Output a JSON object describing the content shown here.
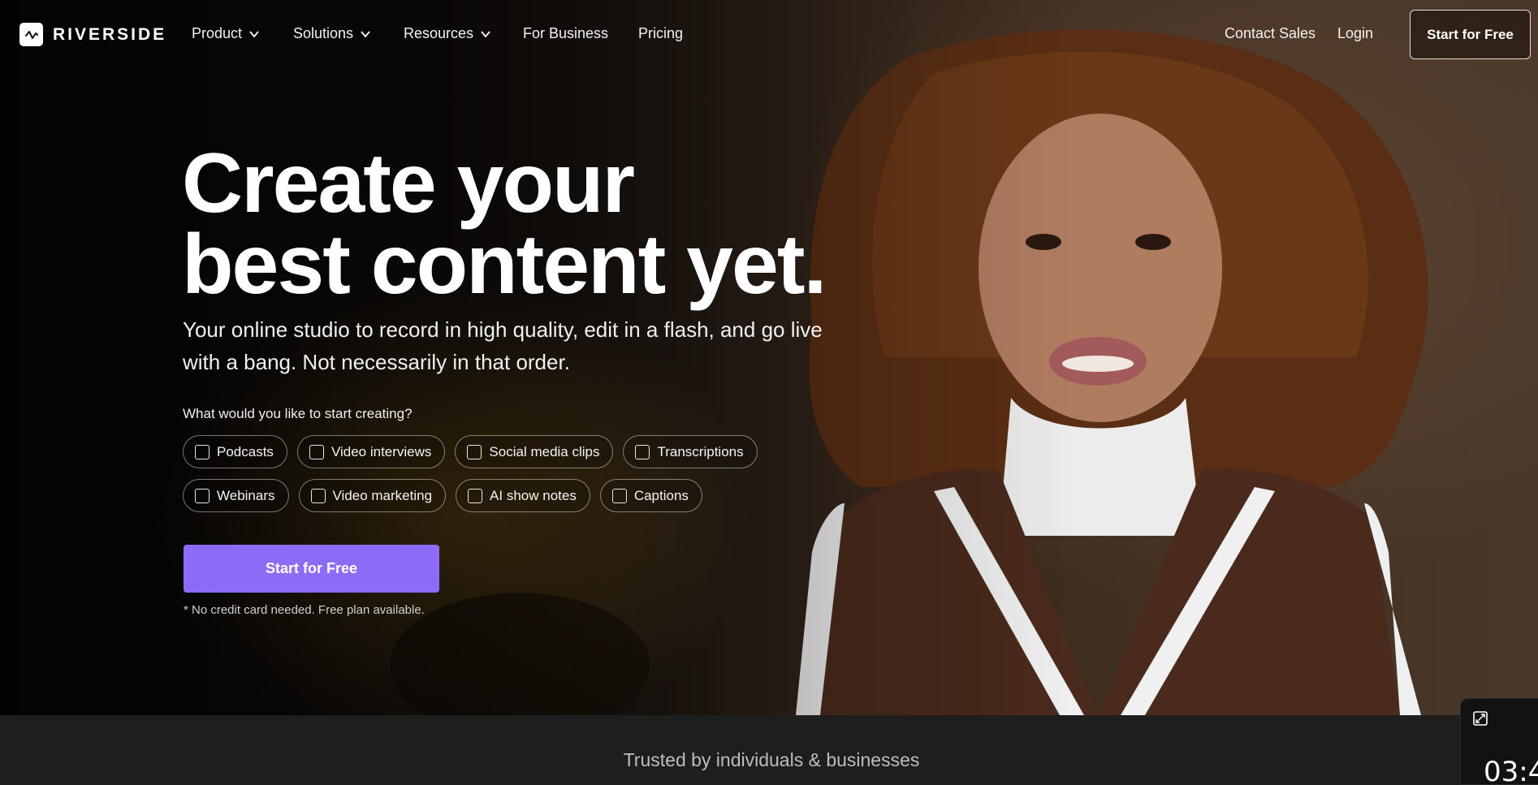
{
  "brand": {
    "name": "RIVERSIDE",
    "logo_icon": "waveform-icon"
  },
  "nav": {
    "items": [
      {
        "label": "Product",
        "has_dropdown": true
      },
      {
        "label": "Solutions",
        "has_dropdown": true
      },
      {
        "label": "Resources",
        "has_dropdown": true
      },
      {
        "label": "For Business",
        "has_dropdown": false
      },
      {
        "label": "Pricing",
        "has_dropdown": false
      }
    ],
    "contact_sales": "Contact Sales",
    "login": "Login",
    "cta": "Start for Free"
  },
  "hero": {
    "headline_line1": "Create your",
    "headline_line2": "best content yet.",
    "subtitle": "Your online studio to record in high quality, edit in a flash, and go live with a bang. Not necessarily in that order.",
    "question": "What would you like to start creating?",
    "options_row1": [
      "Podcasts",
      "Video interviews",
      "Social media clips",
      "Transcriptions"
    ],
    "options_row2": [
      "Webinars",
      "Video marketing",
      "AI show notes",
      "Captions"
    ],
    "cta": "Start for Free",
    "note": "* No credit card needed. Free plan available."
  },
  "trusted": {
    "text": "Trusted by individuals & businesses"
  },
  "widget": {
    "icon": "expand-icon",
    "timer": "03:4"
  },
  "colors": {
    "accent": "#8c6cf7",
    "bottom_bar": "#1e1e1e"
  }
}
